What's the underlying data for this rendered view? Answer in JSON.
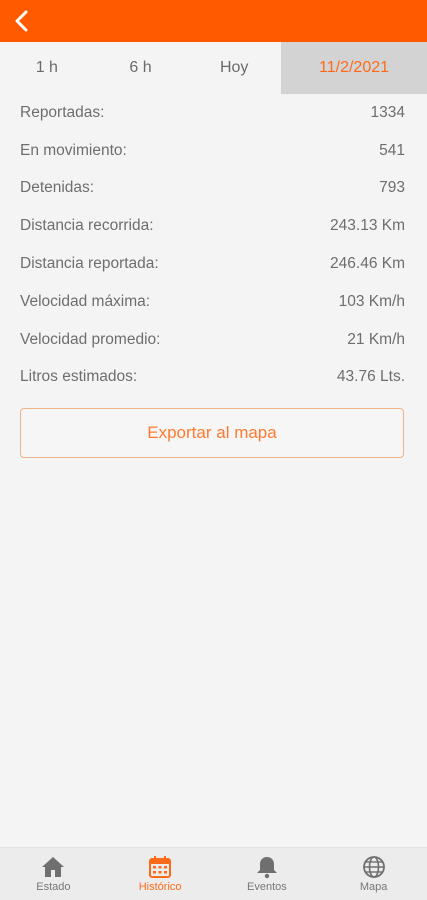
{
  "header": {
    "back_icon": "chevron-left-icon"
  },
  "tabs": [
    {
      "label": "1 h"
    },
    {
      "label": "6 h"
    },
    {
      "label": "Hoy"
    },
    {
      "label": "11/2/2021"
    }
  ],
  "stats": [
    {
      "label": "Reportadas:",
      "value": "1334"
    },
    {
      "label": "En movimiento:",
      "value": "541"
    },
    {
      "label": "Detenidas:",
      "value": "793"
    },
    {
      "label": "Distancia recorrida:",
      "value": "243.13 Km"
    },
    {
      "label": "Distancia reportada:",
      "value": "246.46 Km"
    },
    {
      "label": "Velocidad máxima:",
      "value": "103 Km/h"
    },
    {
      "label": "Velocidad promedio:",
      "value": "21 Km/h"
    },
    {
      "label": "Litros estimados:",
      "value": "43.76 Lts."
    }
  ],
  "export_label": "Exportar al mapa",
  "nav": [
    {
      "label": "Estado",
      "icon": "home-icon"
    },
    {
      "label": "Histórico",
      "icon": "calendar-icon"
    },
    {
      "label": "Eventos",
      "icon": "bell-icon"
    },
    {
      "label": "Mapa",
      "icon": "globe-icon"
    }
  ],
  "colors": {
    "accent": "#ff5a00",
    "active_tab_bg": "#d3d3d3"
  }
}
